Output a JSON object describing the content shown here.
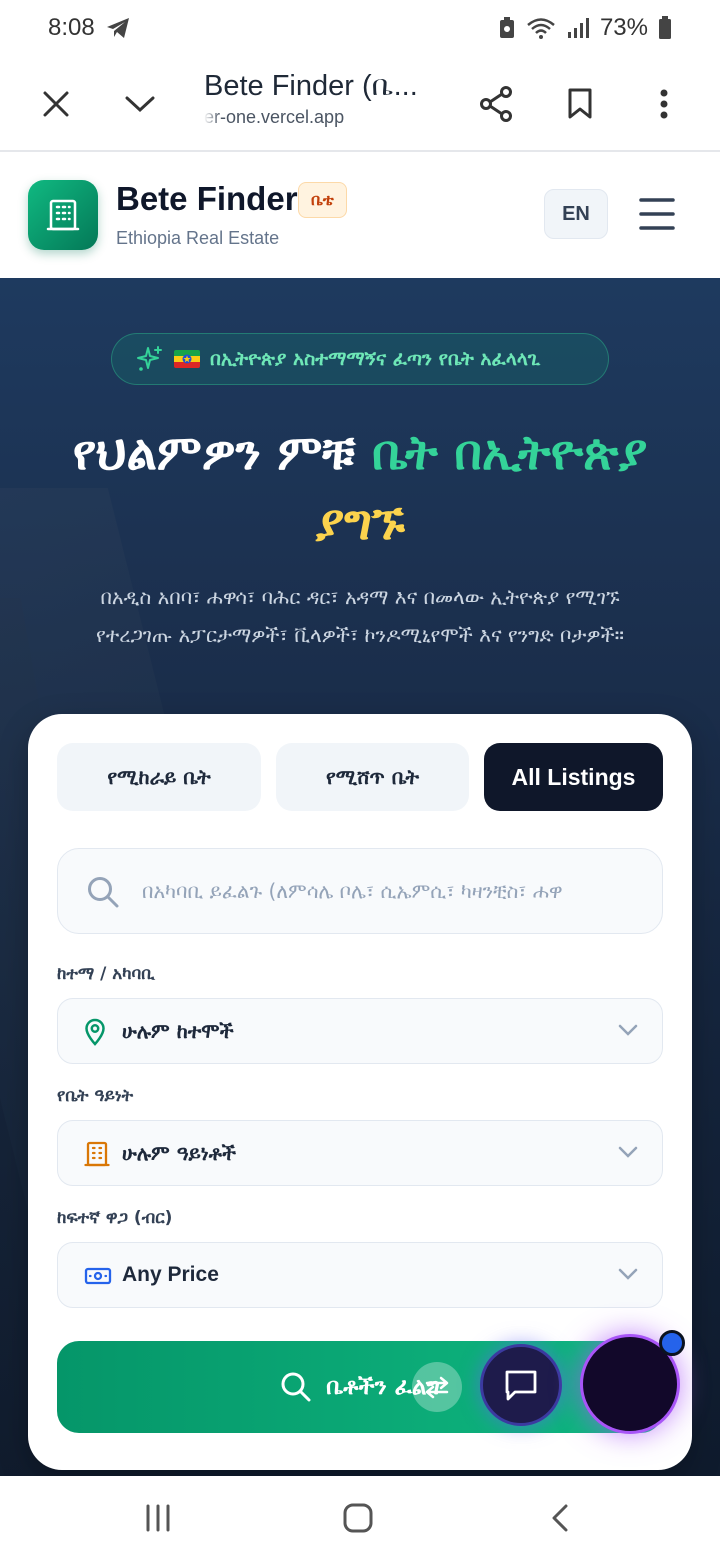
{
  "status_bar": {
    "time": "8:08",
    "battery": "73%"
  },
  "browser": {
    "page_title": "Bete Finder (ቤ...",
    "domain": "er-one.vercel.app"
  },
  "header": {
    "brand_name": "Bete Finder",
    "brand_badge": "ቤቴ",
    "brand_subtitle": "Ethiopia Real Estate",
    "language_button": "EN"
  },
  "hero": {
    "tagline": "በኢትዮጵያ አስተማማኝና ፈጣን የቤት አፈላላጊ",
    "title_part1": "የህልምዎን ምቹ",
    "title_accent": "ቤት በኢትዮጵያ",
    "title_accent2": "ያግኙ",
    "description_line1": "በአዲስ አበባ፣ ሐዋሳ፣ ባሕር ዳር፣ አዳማ እና በመላው ኢትዮጵያ የሚገኙ",
    "description_line2": "የተረጋገጡ አፓርታማዎች፣ ቪላዎች፣ ኮንዶሚኒየሞች እና የንግድ ቦታዎች።"
  },
  "search": {
    "tabs": [
      {
        "label": "የሚከራይ ቤት",
        "active": false
      },
      {
        "label": "የሚሸጥ ቤት",
        "active": false
      },
      {
        "label": "All Listings",
        "active": true
      }
    ],
    "input_placeholder": "በአካባቢ ይፈልጉ (ለምሳሌ ቦሌ፣ ሲኤምሲ፣ ካዛንቺስ፣ ሐዋ",
    "city_label": "ከተማ / አካባቢ",
    "city_value": "ሁሉም ከተሞች",
    "type_label": "የቤት ዓይነት",
    "type_value": "ሁሉም ዓይነቶች",
    "price_label": "ከፍተኛ ዋጋ (ብር)",
    "price_value": "Any Price",
    "submit_label": "ቤቶችን ፈልግ"
  },
  "colors": {
    "accent_green": "#10b981",
    "dark_navy": "#0f172a",
    "accent_yellow": "#fcd34d"
  }
}
